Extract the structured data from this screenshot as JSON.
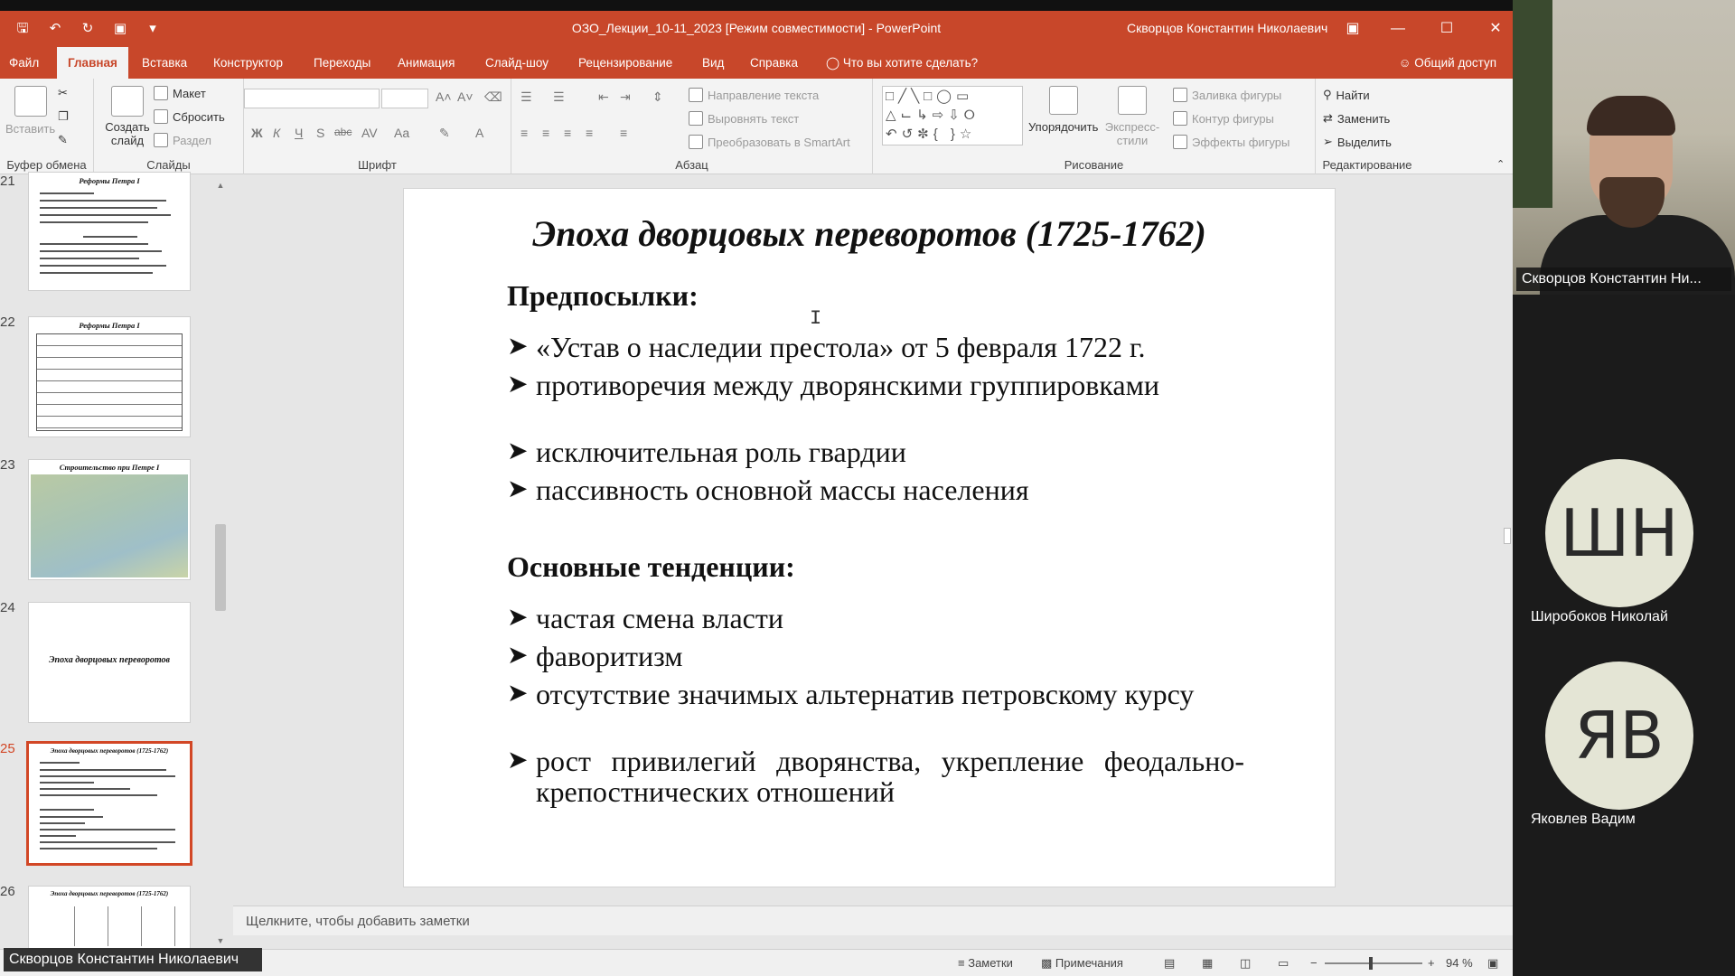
{
  "window": {
    "title": "ОЗО_Лекции_10-11_2023 [Режим совместимости] - PowerPoint",
    "user": "Скворцов Константин Николаевич"
  },
  "ribbon_tabs": [
    "Файл",
    "Главная",
    "Вставка",
    "Конструктор",
    "Переходы",
    "Анимация",
    "Слайд-шоу",
    "Рецензирование",
    "Вид",
    "Справка"
  ],
  "tell_me": "Что вы хотите сделать?",
  "share": "Общий доступ",
  "ribbon": {
    "clipboard": {
      "paste": "Вставить",
      "label": "Буфер обмена"
    },
    "slides": {
      "new_slide": "Создать слайд",
      "layout": "Макет",
      "reset": "Сбросить",
      "section": "Раздел",
      "label": "Слайды"
    },
    "font": {
      "bold": "Ж",
      "italic": "К",
      "underline": "Ч",
      "strike": "S",
      "abc": "abc",
      "av": "AV",
      "aa": "Aa",
      "label": "Шрифт"
    },
    "paragraph": {
      "direction": "Направление текста",
      "align": "Выровнять текст",
      "smartart": "Преобразовать в SmartArt",
      "label": "Абзац"
    },
    "drawing": {
      "arrange": "Упорядочить",
      "quick_styles": "Экспресс-стили",
      "fill": "Заливка фигуры",
      "outline": "Контур фигуры",
      "effects": "Эффекты фигуры",
      "label": "Рисование"
    },
    "editing": {
      "find": "Найти",
      "replace": "Заменить",
      "select": "Выделить",
      "label": "Редактирование"
    }
  },
  "thumbnails": [
    {
      "number": "21",
      "title": "Реформы Петра I",
      "active": false
    },
    {
      "number": "22",
      "title": "Реформы Петра I",
      "active": false
    },
    {
      "number": "23",
      "title": "Строительство при Петре I",
      "active": false
    },
    {
      "number": "24",
      "title": "Эпоха дворцовых переворотов",
      "active": false
    },
    {
      "number": "25",
      "title": "Эпоха дворцовых переворотов (1725-1762)",
      "active": true
    },
    {
      "number": "26",
      "title": "Эпоха дворцовых переворотов (1725-1762)",
      "active": false
    }
  ],
  "slide": {
    "title": "Эпоха дворцовых переворотов (1725-1762)",
    "section1": {
      "heading": "Предпосылки:",
      "bullets": [
        "«Устав о наследии престола» от 5 февраля 1722 г.",
        "противоречия между дворянскими группировками",
        "исключительная роль гвардии",
        "пассивность основной массы населения"
      ]
    },
    "section2": {
      "heading": "Основные тенденции:",
      "bullets": [
        "частая смена власти",
        "фаворитизм",
        "отсутствие значимых альтернатив петровскому курсу",
        "рост привилегий дворянства, укрепление феодально-крепостнических отношений"
      ]
    }
  },
  "notes_placeholder": "Щелкните, чтобы добавить заметки",
  "statusbar": {
    "speaker": "Скворцов Константин Николаевич",
    "notes": "Заметки",
    "comments": "Примечания",
    "zoom": "94 %"
  },
  "participants": {
    "camera_name": "Скворцов Константин Ни...",
    "list": [
      {
        "initials": "ШН",
        "name": "Широбоков Николай"
      },
      {
        "initials": "ЯВ",
        "name": "Яковлев Вадим"
      }
    ]
  },
  "colors": {
    "accent": "#c8472a",
    "ribbon_bg": "#f3f3f3",
    "workspace": "#e6e6e6",
    "avatar_bg": "#e4e5d5"
  }
}
